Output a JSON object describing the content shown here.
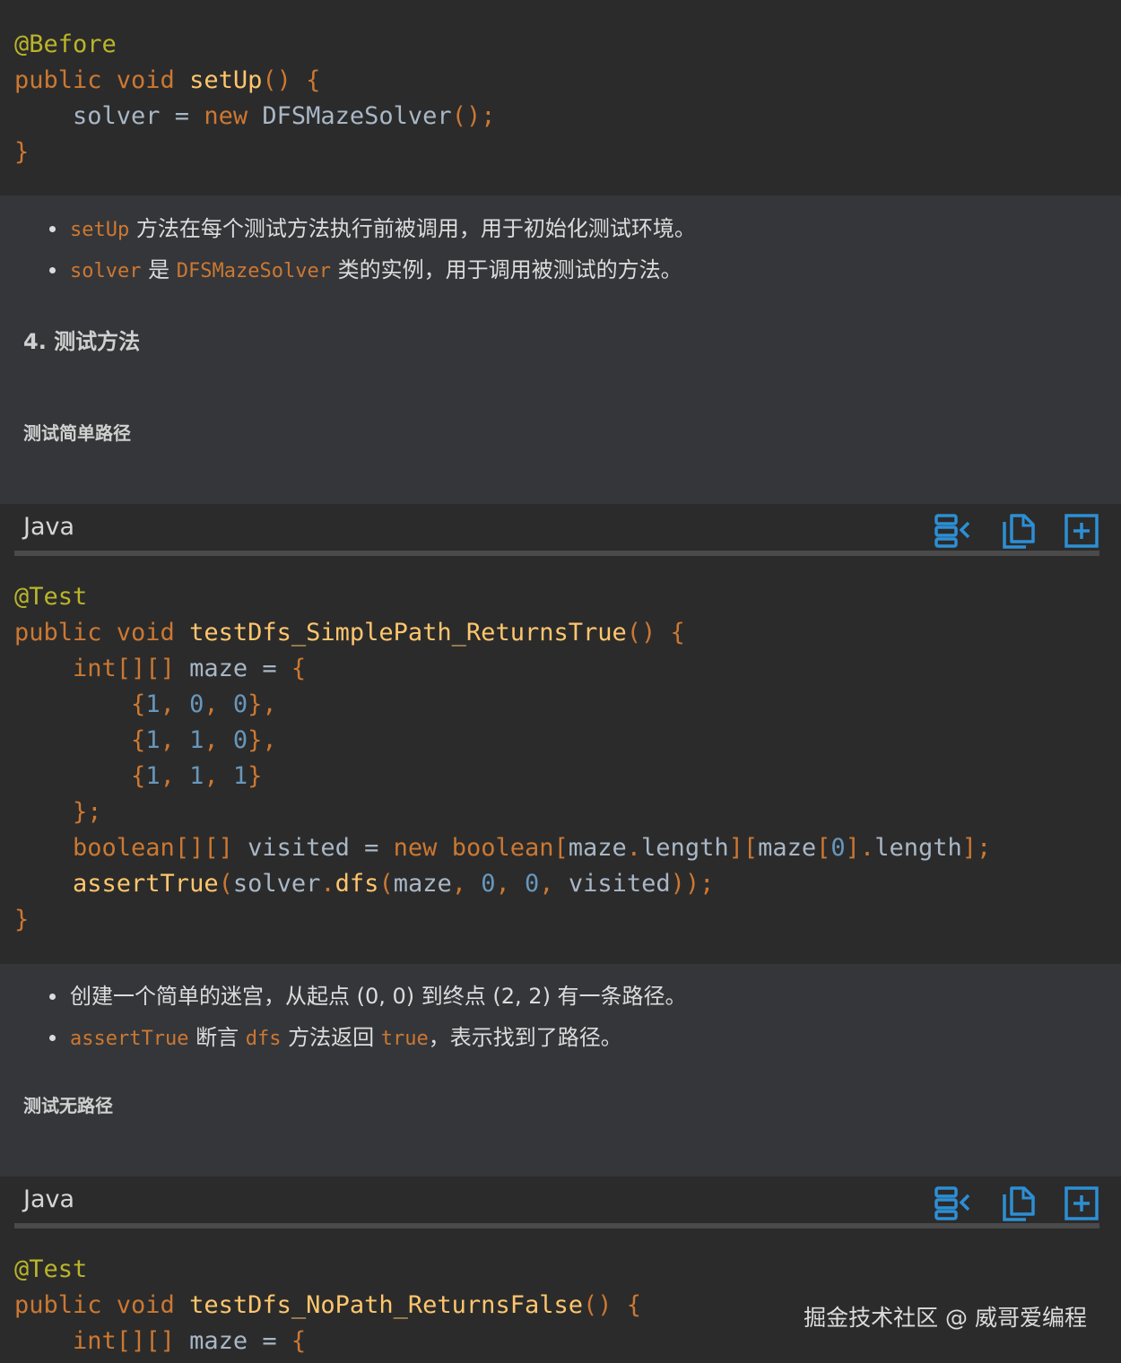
{
  "block1": {
    "lines": [
      [
        {
          "t": "@Before",
          "c": "ann"
        }
      ],
      [
        {
          "t": "public void ",
          "c": "kw"
        },
        {
          "t": "setUp",
          "c": "fn"
        },
        {
          "t": "() {",
          "c": "br"
        }
      ],
      [
        {
          "t": "    solver = ",
          "c": "pl"
        },
        {
          "t": "new ",
          "c": "kw"
        },
        {
          "t": "DFSMazeSolver",
          "c": "pl"
        },
        {
          "t": "();",
          "c": "br"
        }
      ],
      [
        {
          "t": "}",
          "c": "br"
        }
      ]
    ]
  },
  "notes1": [
    {
      "code1": "setUp",
      "text1": " 方法在每个测试方法执行前被调用，用于初始化测试环境。"
    },
    {
      "code1": "solver",
      "text1": " 是 ",
      "code2": "DFSMazeSolver",
      "text2": " 类的实例，用于调用被测试的方法。"
    }
  ],
  "section_heading": "4. 测试方法",
  "sub1": "测试简单路径",
  "code_header": {
    "lang": "Java"
  },
  "icons": {
    "collapse": "collapse-code-icon",
    "copy": "copy-icon",
    "expand": "expand-icon"
  },
  "block2": {
    "lines": [
      [
        {
          "t": "@Test",
          "c": "ann"
        }
      ],
      [
        {
          "t": "public void ",
          "c": "kw"
        },
        {
          "t": "testDfs_SimplePath_ReturnsTrue",
          "c": "fn"
        },
        {
          "t": "() {",
          "c": "br"
        }
      ],
      [
        {
          "t": "    int",
          "c": "kw"
        },
        {
          "t": "[][] ",
          "c": "br"
        },
        {
          "t": "maze = ",
          "c": "pl"
        },
        {
          "t": "{",
          "c": "br"
        }
      ],
      [
        {
          "t": "        {",
          "c": "br"
        },
        {
          "t": "1",
          "c": "num"
        },
        {
          "t": ", ",
          "c": "br"
        },
        {
          "t": "0",
          "c": "num"
        },
        {
          "t": ", ",
          "c": "br"
        },
        {
          "t": "0",
          "c": "num"
        },
        {
          "t": "},",
          "c": "br"
        }
      ],
      [
        {
          "t": "        {",
          "c": "br"
        },
        {
          "t": "1",
          "c": "num"
        },
        {
          "t": ", ",
          "c": "br"
        },
        {
          "t": "1",
          "c": "num"
        },
        {
          "t": ", ",
          "c": "br"
        },
        {
          "t": "0",
          "c": "num"
        },
        {
          "t": "},",
          "c": "br"
        }
      ],
      [
        {
          "t": "        {",
          "c": "br"
        },
        {
          "t": "1",
          "c": "num"
        },
        {
          "t": ", ",
          "c": "br"
        },
        {
          "t": "1",
          "c": "num"
        },
        {
          "t": ", ",
          "c": "br"
        },
        {
          "t": "1",
          "c": "num"
        },
        {
          "t": "}",
          "c": "br"
        }
      ],
      [
        {
          "t": "    };",
          "c": "br"
        }
      ],
      [
        {
          "t": "    boolean",
          "c": "kw"
        },
        {
          "t": "[][] ",
          "c": "br"
        },
        {
          "t": "visited = ",
          "c": "pl"
        },
        {
          "t": "new ",
          "c": "kw"
        },
        {
          "t": "boolean",
          "c": "kw"
        },
        {
          "t": "[",
          "c": "br"
        },
        {
          "t": "maze",
          "c": "pl"
        },
        {
          "t": ".",
          "c": "br"
        },
        {
          "t": "length",
          "c": "pl"
        },
        {
          "t": "][",
          "c": "br"
        },
        {
          "t": "maze",
          "c": "pl"
        },
        {
          "t": "[",
          "c": "br"
        },
        {
          "t": "0",
          "c": "num"
        },
        {
          "t": "].",
          "c": "br"
        },
        {
          "t": "length",
          "c": "pl"
        },
        {
          "t": "];",
          "c": "br"
        }
      ],
      [
        {
          "t": "    assertTrue",
          "c": "fn"
        },
        {
          "t": "(",
          "c": "br"
        },
        {
          "t": "solver",
          "c": "pl"
        },
        {
          "t": ".",
          "c": "br"
        },
        {
          "t": "dfs",
          "c": "fn"
        },
        {
          "t": "(",
          "c": "br"
        },
        {
          "t": "maze",
          "c": "pl"
        },
        {
          "t": ", ",
          "c": "br"
        },
        {
          "t": "0",
          "c": "num"
        },
        {
          "t": ", ",
          "c": "br"
        },
        {
          "t": "0",
          "c": "num"
        },
        {
          "t": ", ",
          "c": "br"
        },
        {
          "t": "visited",
          "c": "pl"
        },
        {
          "t": "));",
          "c": "br"
        }
      ],
      [
        {
          "t": "}",
          "c": "br"
        }
      ]
    ]
  },
  "notes2": [
    {
      "text1": "创建一个简单的迷宫，从起点 (0, 0) 到终点 (2, 2) 有一条路径。"
    },
    {
      "code1": "assertTrue",
      "text1": " 断言 ",
      "code2": "dfs",
      "text2": " 方法返回 ",
      "code3": "true",
      "text3": "，表示找到了路径。"
    }
  ],
  "sub2": "测试无路径",
  "block3": {
    "lines": [
      [
        {
          "t": "@Test",
          "c": "ann"
        }
      ],
      [
        {
          "t": "public void ",
          "c": "kw"
        },
        {
          "t": "testDfs_NoPath_ReturnsFalse",
          "c": "fn"
        },
        {
          "t": "() {",
          "c": "br"
        }
      ],
      [
        {
          "t": "    int",
          "c": "kw"
        },
        {
          "t": "[][] ",
          "c": "br"
        },
        {
          "t": "maze = ",
          "c": "pl"
        },
        {
          "t": "{",
          "c": "br"
        }
      ]
    ]
  },
  "watermark": "掘金技术社区 @ 威哥爱编程"
}
